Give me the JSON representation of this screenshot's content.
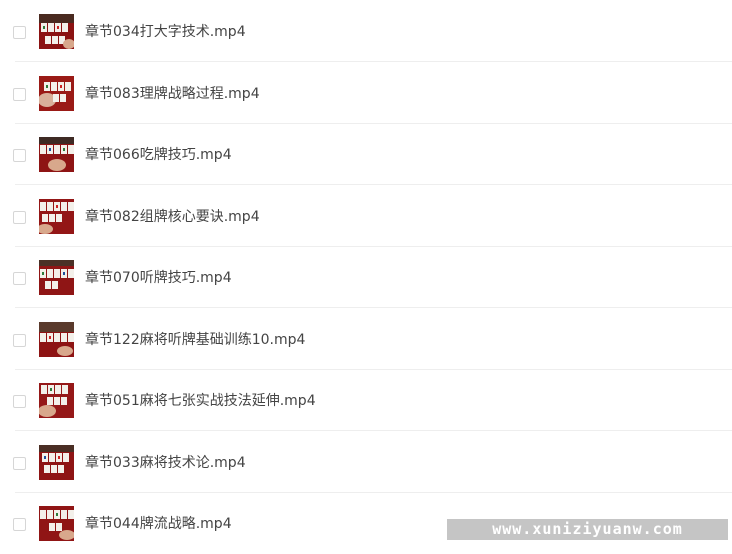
{
  "files": [
    {
      "name": "章节034打大字技术.mp4"
    },
    {
      "name": "章节083理牌战略过程.mp4"
    },
    {
      "name": "章节066吃牌技巧.mp4"
    },
    {
      "name": "章节082组牌核心要诀.mp4"
    },
    {
      "name": "章节070听牌技巧.mp4"
    },
    {
      "name": "章节122麻将听牌基础训练10.mp4"
    },
    {
      "name": "章节051麻将七张实战技法延伸.mp4"
    },
    {
      "name": "章节033麻将技术论.mp4"
    },
    {
      "name": "章节044牌流战略.mp4"
    }
  ],
  "watermark": {
    "text": "www.xuniziyuanw.com"
  },
  "colors": {
    "text": "#444444",
    "divider": "#eeeeee",
    "checkbox_border": "#d6d6d6",
    "thumbnail_felt": "#8b1212"
  }
}
